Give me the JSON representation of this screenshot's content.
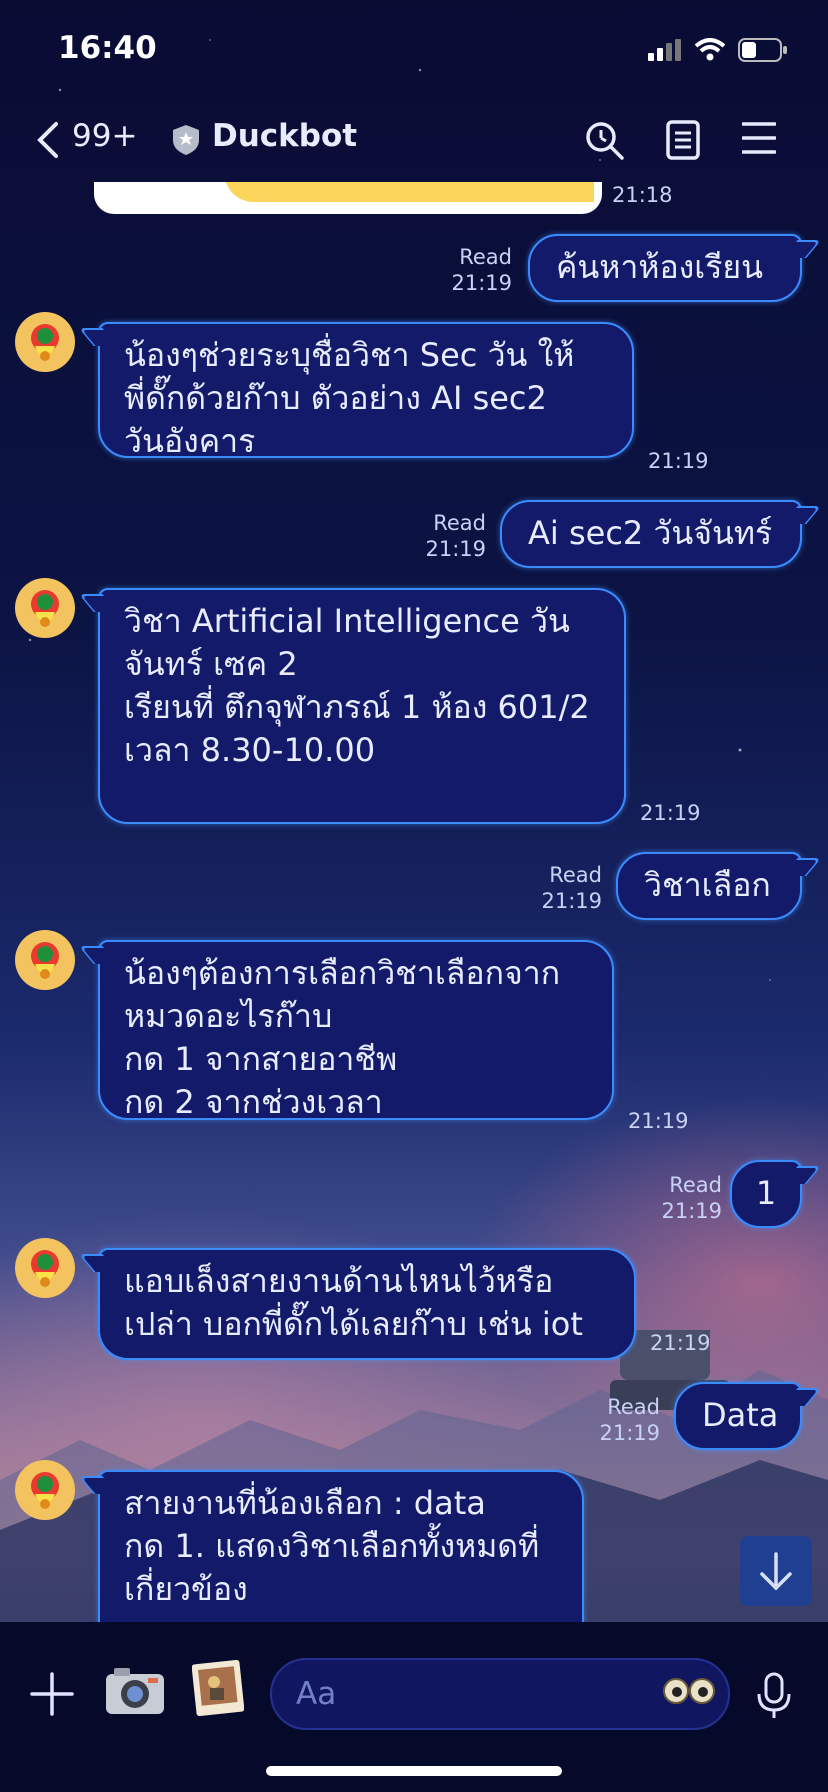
{
  "status_bar": {
    "time": "16:40"
  },
  "header": {
    "unread_count": "99+",
    "title": "Duckbot"
  },
  "messages": [
    {
      "time": "21:18"
    },
    {
      "direction": "out",
      "text": "ค้นหาห้องเรียน",
      "read": "Read",
      "time": "21:19"
    },
    {
      "direction": "in",
      "lines": [
        "น้องๆช่วยระบุชื่อวิชา  Sec  วัน ให้",
        "พี่ดั๊กด้วยก๊าบ ตัวอย่าง AI sec2",
        "วันอังคาร"
      ],
      "time": "21:19"
    },
    {
      "direction": "out",
      "text": "Ai sec2 วันจันทร์",
      "read": "Read",
      "time": "21:19"
    },
    {
      "direction": "in",
      "lines": [
        "วิชา Artificial Intelligence วัน",
        "จันทร์ เซค 2",
        "เรียนที่ ตึกจุฬาภรณ์ 1 ห้อง 601/2",
        "เวลา 8.30-10.00"
      ],
      "time": "21:19"
    },
    {
      "direction": "out",
      "text": "วิชาเลือก",
      "read": "Read",
      "time": "21:19"
    },
    {
      "direction": "in",
      "lines": [
        "น้องๆต้องการเลือกวิชาเลือกจาก",
        "หมวดอะไรก๊าบ",
        "กด 1 จากสายอาชีพ",
        "กด 2 จากช่วงเวลา"
      ],
      "time": "21:19"
    },
    {
      "direction": "out",
      "text": "1",
      "read": "Read",
      "time": "21:19"
    },
    {
      "direction": "in",
      "lines": [
        "แอบเล็งสายงานด้านไหนไว้หรือ",
        "เปล่า บอกพี่ดั๊กได้เลยก๊าบ เช่น iot"
      ],
      "time": "21:19"
    },
    {
      "direction": "out",
      "text": "Data",
      "read": "Read",
      "time": "21:19"
    },
    {
      "direction": "in",
      "lines": [
        "สายงานที่น้องเลือก : data",
        "กด 1. แสดงวิชาเลือกทั้งหมดที่",
        "เกี่ยวข้อง"
      ]
    }
  ],
  "input": {
    "placeholder": "Aa"
  },
  "icons": {
    "back": "chevron-left-icon",
    "verified": "shield-star-icon",
    "search": "search-icon",
    "notes": "notes-icon",
    "menu": "menu-icon",
    "scroll": "arrow-down-icon",
    "plus": "plus-icon",
    "camera": "camera-icon",
    "photo": "photo-icon",
    "emoji": "emoji-icon",
    "mic": "microphone-icon"
  },
  "colors": {
    "bubble_fill": "#131a6a",
    "bubble_border": "#3a8bff",
    "background_top": "#090b33"
  }
}
